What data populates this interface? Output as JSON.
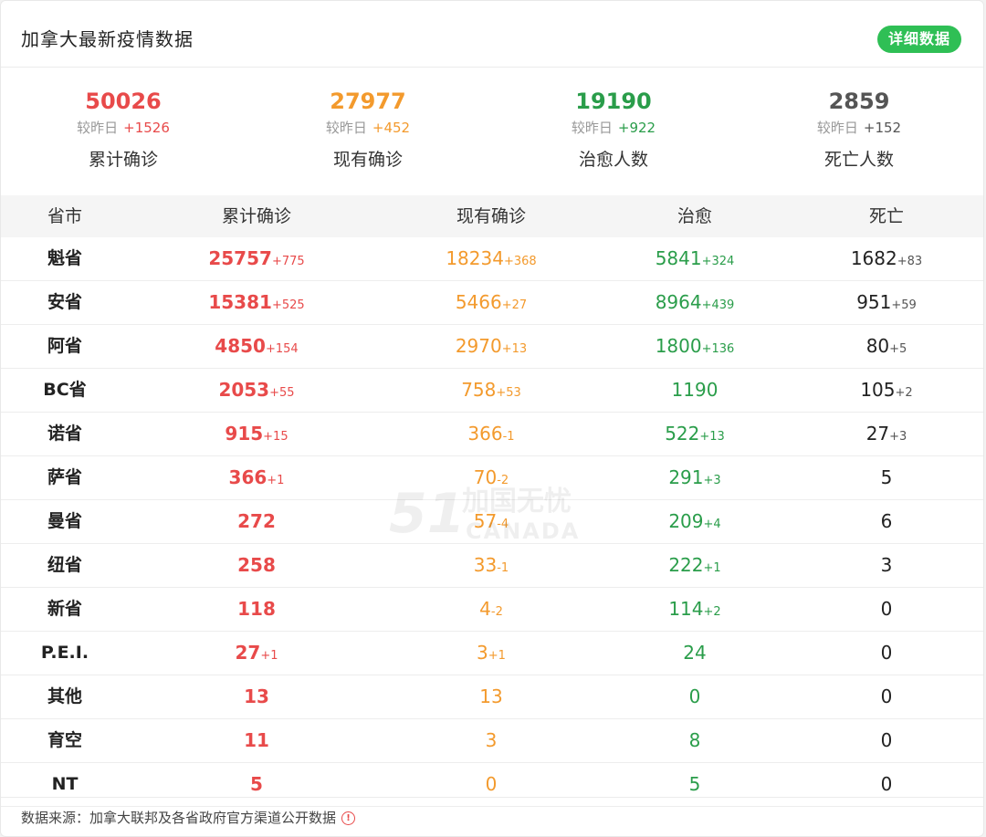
{
  "header": {
    "title": "加拿大最新疫情数据",
    "detail_button": "详细数据"
  },
  "summary": [
    {
      "value": "50026",
      "compare_label": "较昨日",
      "delta": "+1526",
      "label": "累计确诊",
      "color": "#e84a4a"
    },
    {
      "value": "27977",
      "compare_label": "较昨日",
      "delta": "+452",
      "label": "现有确诊",
      "color": "#f39a2d"
    },
    {
      "value": "19190",
      "compare_label": "较昨日",
      "delta": "+922",
      "label": "治愈人数",
      "color": "#2a9d4a"
    },
    {
      "value": "2859",
      "compare_label": "较昨日",
      "delta": "+152",
      "label": "死亡人数",
      "color": "#555555"
    }
  ],
  "table": {
    "headers": [
      "省市",
      "累计确诊",
      "现有确诊",
      "治愈",
      "死亡"
    ],
    "rows": [
      {
        "name": "魁省",
        "total": "25757",
        "total_d": "+775",
        "active": "18234",
        "active_d": "+368",
        "cured": "5841",
        "cured_d": "+324",
        "dead": "1682",
        "dead_d": "+83"
      },
      {
        "name": "安省",
        "total": "15381",
        "total_d": "+525",
        "active": "5466",
        "active_d": "+27",
        "cured": "8964",
        "cured_d": "+439",
        "dead": "951",
        "dead_d": "+59"
      },
      {
        "name": "阿省",
        "total": "4850",
        "total_d": "+154",
        "active": "2970",
        "active_d": "+13",
        "cured": "1800",
        "cured_d": "+136",
        "dead": "80",
        "dead_d": "+5"
      },
      {
        "name": "BC省",
        "total": "2053",
        "total_d": "+55",
        "active": "758",
        "active_d": "+53",
        "cured": "1190",
        "cured_d": "",
        "dead": "105",
        "dead_d": "+2"
      },
      {
        "name": "诺省",
        "total": "915",
        "total_d": "+15",
        "active": "366",
        "active_d": "-1",
        "cured": "522",
        "cured_d": "+13",
        "dead": "27",
        "dead_d": "+3"
      },
      {
        "name": "萨省",
        "total": "366",
        "total_d": "+1",
        "active": "70",
        "active_d": "-2",
        "cured": "291",
        "cured_d": "+3",
        "dead": "5",
        "dead_d": ""
      },
      {
        "name": "曼省",
        "total": "272",
        "total_d": "",
        "active": "57",
        "active_d": "-4",
        "cured": "209",
        "cured_d": "+4",
        "dead": "6",
        "dead_d": ""
      },
      {
        "name": "纽省",
        "total": "258",
        "total_d": "",
        "active": "33",
        "active_d": "-1",
        "cured": "222",
        "cured_d": "+1",
        "dead": "3",
        "dead_d": ""
      },
      {
        "name": "新省",
        "total": "118",
        "total_d": "",
        "active": "4",
        "active_d": "-2",
        "cured": "114",
        "cured_d": "+2",
        "dead": "0",
        "dead_d": ""
      },
      {
        "name": "P.E.I.",
        "total": "27",
        "total_d": "+1",
        "active": "3",
        "active_d": "+1",
        "cured": "24",
        "cured_d": "",
        "dead": "0",
        "dead_d": ""
      },
      {
        "name": "其他",
        "total": "13",
        "total_d": "",
        "active": "13",
        "active_d": "",
        "cured": "0",
        "cured_d": "",
        "dead": "0",
        "dead_d": ""
      },
      {
        "name": "育空",
        "total": "11",
        "total_d": "",
        "active": "3",
        "active_d": "",
        "cured": "8",
        "cured_d": "",
        "dead": "0",
        "dead_d": ""
      },
      {
        "name": "NT",
        "total": "5",
        "total_d": "",
        "active": "0",
        "active_d": "",
        "cured": "5",
        "cured_d": "",
        "dead": "0",
        "dead_d": ""
      }
    ]
  },
  "watermark": {
    "big": "51",
    "cn": "加国无忧",
    "en": "CANADA"
  },
  "footer": {
    "text": "数据来源：加拿大联邦及各省政府官方渠道公开数据"
  }
}
